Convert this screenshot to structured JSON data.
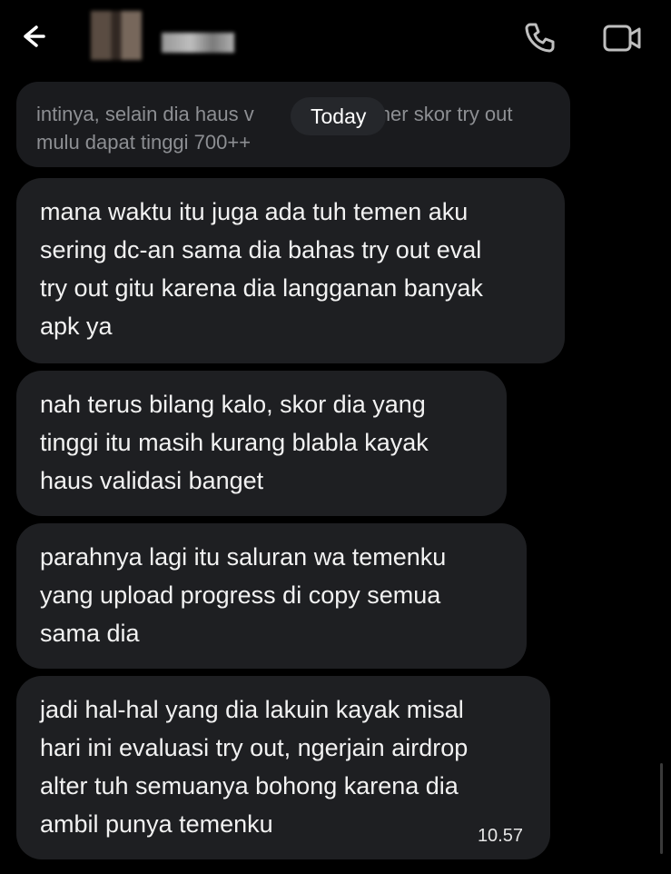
{
  "header": {
    "back_icon": "arrow-left-icon",
    "call_icon": "phone-icon",
    "video_icon": "video-camera-icon"
  },
  "quoted": {
    "text": "intinya, selain dia haus v      mer skor try out mulu dapat tinggi 700++"
  },
  "date_pill": "Today",
  "messages": [
    {
      "text": "mana waktu itu juga ada tuh temen aku\nsering dc-an sama dia bahas try out eval\ntry out gitu karena dia langganan banyak\napk ya"
    },
    {
      "text": "nah terus bilang kalo, skor dia yang\ntinggi itu masih kurang blabla kayak\nhaus validasi banget"
    },
    {
      "text": "parahnya lagi itu saluran wa temenku\nyang upload progress di copy semua\nsama dia"
    },
    {
      "text": "jadi hal-hal yang dia lakuin kayak misal\nhari ini evaluasi try out, ngerjain airdrop\nalter tuh semuanya bohong karena dia\nambil punya temenku",
      "time": "10.57"
    }
  ],
  "colors": {
    "background": "#000000",
    "bubble": "#1e1f22",
    "quoted_text": "#8d8f93"
  }
}
